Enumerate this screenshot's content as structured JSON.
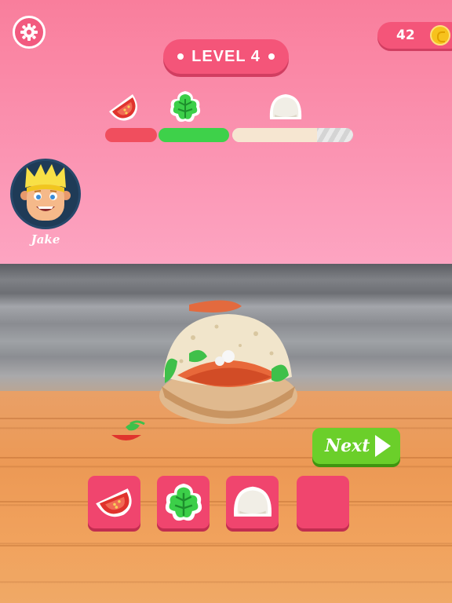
{
  "hud": {
    "level_label": "LEVEL 4",
    "coins": "42"
  },
  "progress": [
    {
      "ingredient": "tomato",
      "icon": "tomato-slice-icon",
      "fill": 1.0,
      "color": "#f04e5e"
    },
    {
      "ingredient": "lettuce",
      "icon": "lettuce-leaf-icon",
      "fill": 1.0,
      "color": "#3ed14a"
    },
    {
      "ingredient": "mozzarella",
      "icon": "mozzarella-ball-icon",
      "fill": 0.7,
      "color": "#f6e6d1"
    }
  ],
  "player": {
    "name": "Jake",
    "avatar_icon": "boy-with-crown-icon"
  },
  "actions": {
    "next_label": "Next"
  },
  "ingredient_slots": [
    {
      "icon": "tomato-slice-icon"
    },
    {
      "icon": "lettuce-leaf-icon"
    },
    {
      "icon": "mozzarella-ball-icon"
    },
    {
      "icon": ""
    }
  ],
  "colors": {
    "accent": "#f45579",
    "next_button": "#6bcf2a"
  }
}
